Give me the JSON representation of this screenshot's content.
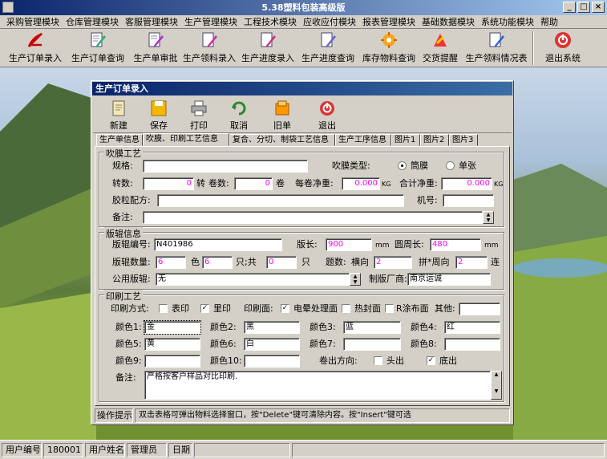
{
  "app": {
    "title": "5.38塑料包装高级版"
  },
  "menu": [
    "采购管理模块",
    "仓库管理模块",
    "客服管理模块",
    "生产管理模块",
    "工程技术模块",
    "应收应付模块",
    "报表管理模块",
    "基础数据模块",
    "系统功能模块",
    "帮助"
  ],
  "toolbar": {
    "buttons": [
      {
        "label": "生产订单录入",
        "icon": "acrobat-icon"
      },
      {
        "label": "生产订单查询",
        "icon": "document-pen-icon"
      },
      {
        "label": "生产单审批",
        "icon": "approve-pen-icon"
      },
      {
        "label": "生产领料录入",
        "icon": "material-pen-icon"
      },
      {
        "label": "生产进度录入",
        "icon": "progress-pen-icon"
      },
      {
        "label": "生产进度查询",
        "icon": "progress-query-icon"
      },
      {
        "label": "库存物料查询",
        "icon": "inventory-icon"
      },
      {
        "label": "交货提醒",
        "icon": "delivery-icon"
      },
      {
        "label": "生产领料情况表",
        "icon": "report-icon"
      },
      {
        "label": "退出系统",
        "icon": "exit-icon"
      }
    ]
  },
  "window": {
    "title": "生产订单录入",
    "buttons": {
      "new": "新建",
      "save": "保存",
      "print": "打印",
      "cancel": "取消",
      "old": "旧单",
      "exit": "退出"
    },
    "tabs": [
      "生产单信息",
      "吹膜、印刷工艺信息",
      "复合、分切、制袋工艺信息",
      "生产工序信息",
      "图片1",
      "图片2",
      "图片3"
    ],
    "blow": {
      "group_title": "吹膜工艺",
      "spec_label": "规格:",
      "spec": "",
      "type_label": "吹膜类型:",
      "opt_tube": "筒膜",
      "opt_single": "单张",
      "rpm_label": "转数:",
      "rpm": "0",
      "rpm_unit": "转",
      "rolls_label": "卷数:",
      "rolls": "0",
      "rolls_unit": "卷",
      "net_label": "每卷净重:",
      "net": "0.000",
      "net_unit": "KG",
      "total_label": "合计净重:",
      "total": "0.000",
      "total_unit": "KG",
      "formula_label": "胶粒配方:",
      "formula": "",
      "machine_label": "机号:",
      "machine": "",
      "note_label": "备注:",
      "note": ""
    },
    "plate": {
      "group_title": "版辊信息",
      "no_label": "版辊编号:",
      "no": "N401986",
      "len_label": "版长:",
      "len": "900",
      "len_unit": "mm",
      "circ_label": "圆周长:",
      "circ": "480",
      "circ_unit": "mm",
      "qty_label": "版辊数量:",
      "qty": "6",
      "color_unit": "色",
      "count": "6",
      "count_unit": "只;共",
      "total": "0",
      "total_unit": "只",
      "spacing_label": "题数:",
      "horiz_label": "横向",
      "horiz": "2",
      "joint_label": "拼*周向",
      "joint": "2",
      "joint_unit": "连",
      "public_label": "公用版辊:",
      "public": "无",
      "maker_label": "制版厂商:",
      "maker": "南京运诚"
    },
    "print": {
      "group_title": "印刷工艺",
      "method_label": "印刷方式:",
      "surface_label": "表印",
      "inner_label": "里印",
      "face_label": "印刷面:",
      "corona_label": "电晕处理面",
      "heat_label": "热封面",
      "coat_label": "R涂布面",
      "other_label": "其他:",
      "other": "",
      "colors": [
        {
          "label": "颜色1:",
          "value": "金"
        },
        {
          "label": "颜色2:",
          "value": "黑"
        },
        {
          "label": "颜色3:",
          "value": "蓝"
        },
        {
          "label": "颜色4:",
          "value": "红"
        },
        {
          "label": "颜色5:",
          "value": "黄"
        },
        {
          "label": "颜色6:",
          "value": "白"
        },
        {
          "label": "颜色7:",
          "value": ""
        },
        {
          "label": "颜色8:",
          "value": ""
        },
        {
          "label": "颜色9:",
          "value": ""
        },
        {
          "label": "颜色10:",
          "value": ""
        }
      ],
      "rewind_label": "卷出方向:",
      "head_label": "头出",
      "bottom_label": "底出",
      "note_label": "备注:",
      "note": "严格按客户样品对比印刷."
    },
    "hint": {
      "label": "操作提示",
      "text": "双击表格可弹出物料选择窗口，按\"Delete\"键可清除内容。按\"Insert\"键可选"
    }
  },
  "status": {
    "uid_label": "用户编号",
    "uid": "180001",
    "uname_label": "用户姓名",
    "uname": "管理员",
    "date_label": "日期"
  }
}
